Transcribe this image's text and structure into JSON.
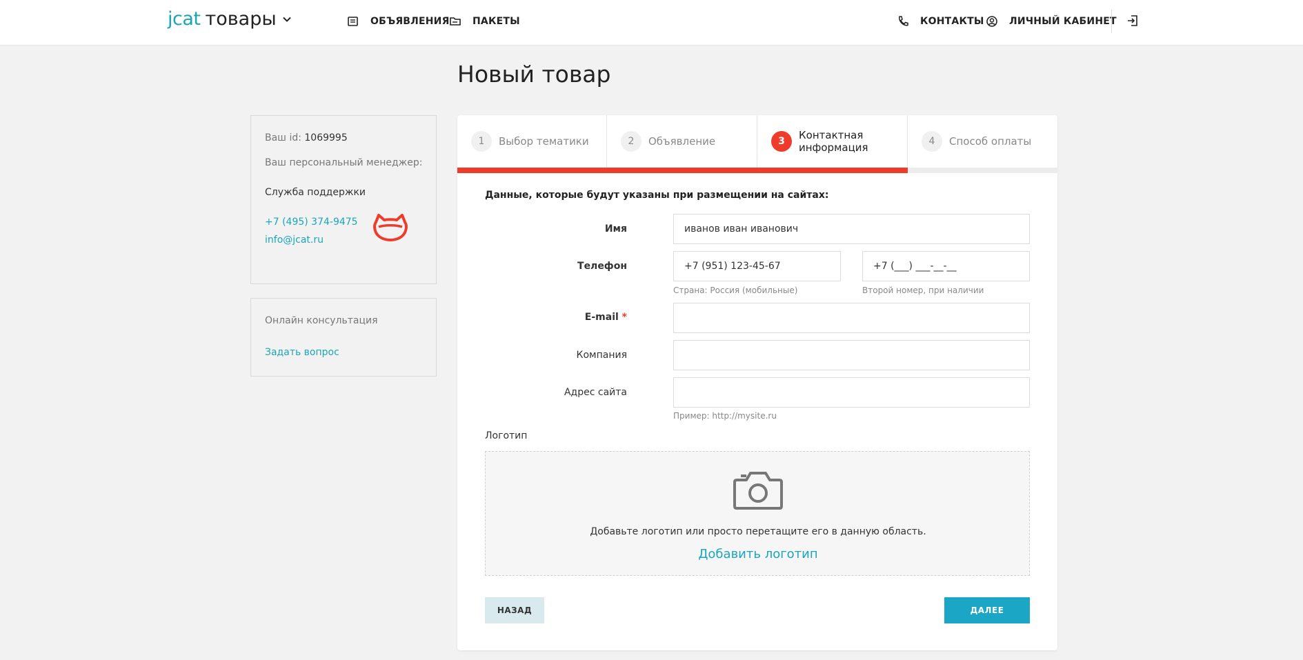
{
  "header": {
    "brand_logo": "jcat",
    "brand_name": "товары",
    "nav": {
      "ads": "ОБЪЯВЛЕНИЯ",
      "packages": "ПАКЕТЫ",
      "contacts": "КОНТАКТЫ",
      "cabinet": "ЛИЧНЫЙ КАБИНЕТ"
    }
  },
  "page": {
    "title": "Новый товар"
  },
  "sidebar": {
    "id_label": "Ваш id:",
    "id_value": "1069995",
    "manager_label": "Ваш персональный менеджер:",
    "manager_name": "Служба поддержки",
    "phone": "+7 (495) 374-9475",
    "email": "info@jcat.ru",
    "consult_title": "Онлайн консультация",
    "ask_link": "Задать вопрос"
  },
  "steps": [
    {
      "num": "1",
      "label": "Выбор тематики"
    },
    {
      "num": "2",
      "label": "Объявление"
    },
    {
      "num": "3",
      "label": "Контактная информация"
    },
    {
      "num": "4",
      "label": "Способ оплаты"
    }
  ],
  "progress": {
    "current_step": 3,
    "total_steps": 4
  },
  "form": {
    "intro": "Данные, которые будут указаны при размещении на сайтах:",
    "name_label": "Имя",
    "name_value": "иванов иван иванович",
    "phone_label": "Телефон",
    "phone_value": "+7 (951) 123-45-67",
    "phone_hint": "Страна: Россия (мобильные)",
    "phone2_placeholder": "+7 (___) ___-__-__",
    "phone2_hint": "Второй номер, при наличии",
    "email_label": "E-mail",
    "email_required": "*",
    "email_value": "",
    "company_label": "Компания",
    "company_value": "",
    "site_label": "Адрес сайта",
    "site_value": "",
    "site_hint": "Пример: http://mysite.ru",
    "logo_label": "Логотип",
    "drop_text": "Добавьте логотип или просто перетащите его в данную область.",
    "drop_link": "Добавить логотип"
  },
  "buttons": {
    "back": "НАЗАД",
    "next": "ДАЛЕЕ"
  },
  "colors": {
    "accent": "#1aa6b9",
    "active_step": "#ef3b2a",
    "next_button": "#1aa6c4",
    "back_button": "#d9eaee"
  }
}
